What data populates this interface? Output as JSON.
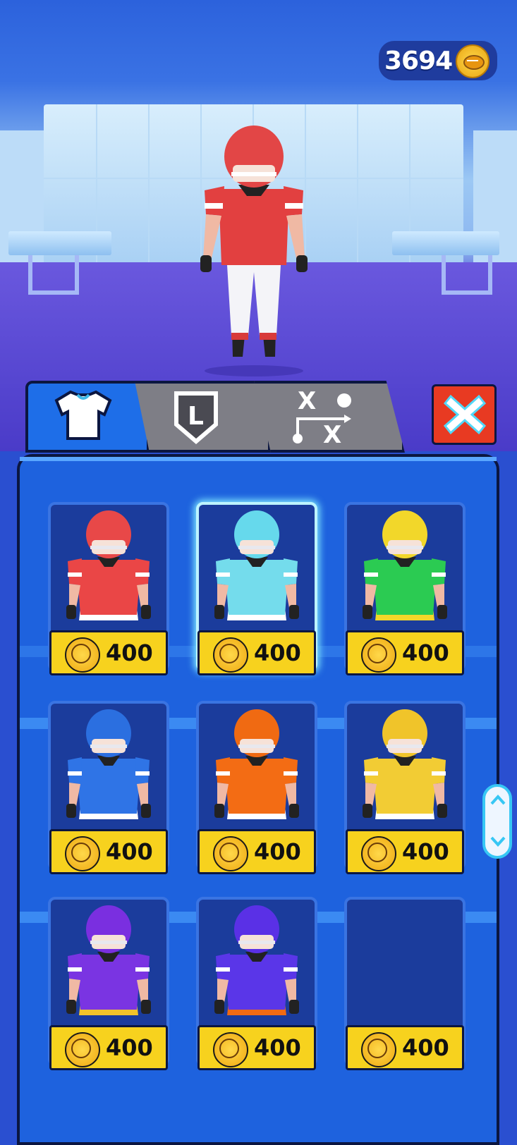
{
  "currency": {
    "amount": "3694",
    "icon": "football-coin-icon"
  },
  "tabs": [
    {
      "name": "outfits",
      "icon": "jersey-icon",
      "active": true
    },
    {
      "name": "badges",
      "icon": "badge-l-icon",
      "active": false
    },
    {
      "name": "plays",
      "icon": "playbook-icon",
      "active": false
    }
  ],
  "tab_icons": {
    "badge_letter": "L",
    "play_x1": "X",
    "play_x2": "X"
  },
  "close": {
    "icon": "close-x-icon"
  },
  "colors": {
    "accent": "#1e62de",
    "price_bg": "#f7d21e",
    "close": "#e83a22"
  },
  "shop": {
    "items": [
      {
        "name": "red",
        "price": "400",
        "helmet": "#e84848",
        "jersey": "#ea4646",
        "pants": "#ffffff",
        "selected": false,
        "visible": true
      },
      {
        "name": "cyan",
        "price": "400",
        "helmet": "#66d9ec",
        "jersey": "#74dcec",
        "pants": "#ffffff",
        "selected": true,
        "visible": true
      },
      {
        "name": "green",
        "price": "400",
        "helmet": "#f2d72a",
        "jersey": "#2bcb52",
        "pants": "#f2d72a",
        "selected": false,
        "visible": true
      },
      {
        "name": "blue",
        "price": "400",
        "helmet": "#2b6fe0",
        "jersey": "#2f74e6",
        "pants": "#ffffff",
        "selected": false,
        "visible": true
      },
      {
        "name": "orange",
        "price": "400",
        "helmet": "#f06a12",
        "jersey": "#f36c14",
        "pants": "#ffffff",
        "selected": false,
        "visible": true
      },
      {
        "name": "gold",
        "price": "400",
        "helmet": "#f0c42a",
        "jersey": "#f2cc34",
        "pants": "#ffffff",
        "selected": false,
        "visible": true
      },
      {
        "name": "purple",
        "price": "400",
        "helmet": "#7a2fe0",
        "jersey": "#7a34e2",
        "pants": "#f2c42a",
        "selected": false,
        "visible": true
      },
      {
        "name": "violet",
        "price": "400",
        "helmet": "#5a30e6",
        "jersey": "#5a36e8",
        "pants": "#f06a12",
        "selected": false,
        "visible": true
      },
      {
        "name": "empty",
        "price": "400",
        "helmet": "",
        "jersey": "",
        "pants": "",
        "selected": false,
        "visible": false
      }
    ]
  }
}
